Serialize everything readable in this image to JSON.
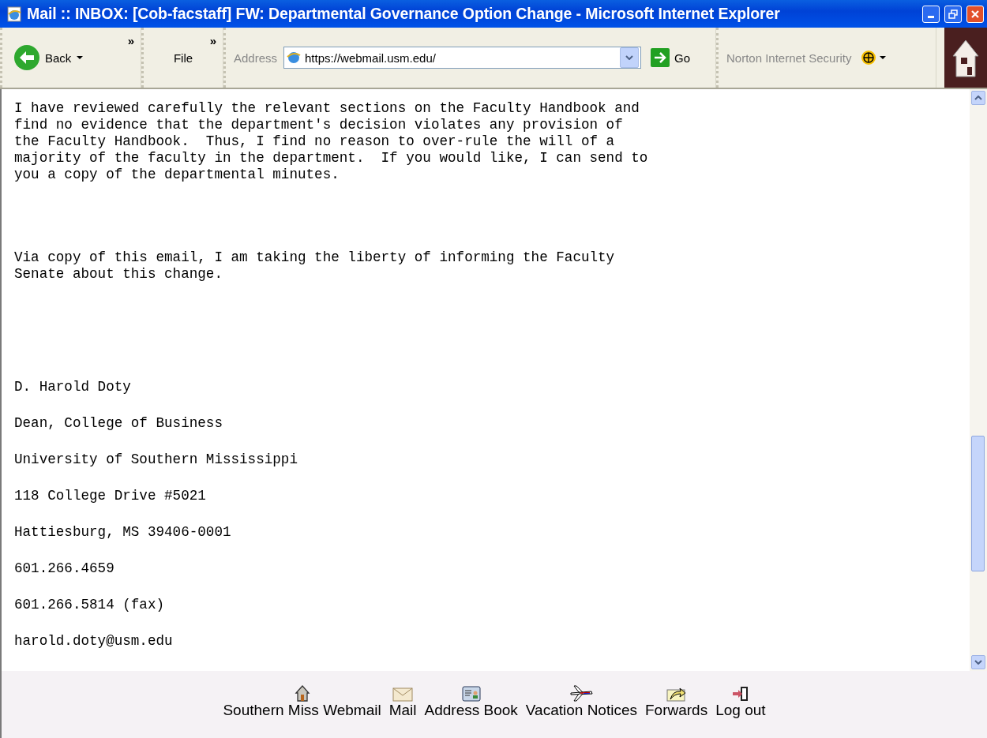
{
  "window": {
    "title": "Mail :: INBOX: [Cob-facstaff] FW: Departmental Governance Option Change - Microsoft Internet Explorer"
  },
  "toolbar": {
    "back": "Back",
    "chevron_1": "»",
    "file": "File",
    "chevron_2": "»",
    "address_label": "Address",
    "address": "https://webmail.usm.edu/",
    "go": "Go",
    "norton": "Norton Internet Security"
  },
  "message": [
    {
      "kind": "paragraph",
      "text": "I have reviewed carefully the relevant sections on the Faculty Handbook and\nfind no evidence that the department's decision violates any provision of\nthe Faculty Handbook.  Thus, I find no reason to over-rule the will of a\nmajority of the faculty in the department.  If you would like, I can send to\nyou a copy of the departmental minutes."
    },
    {
      "kind": "paragraph",
      "text": "Via copy of this email, I am taking the liberty of informing the Faculty\nSenate about this change."
    },
    {
      "kind": "signature",
      "text": "D. Harold Doty"
    },
    {
      "kind": "signature",
      "text": "Dean, College of Business"
    },
    {
      "kind": "signature",
      "text": "University of Southern Mississippi"
    },
    {
      "kind": "signature",
      "text": "118 College Drive #5021"
    },
    {
      "kind": "signature",
      "text": "Hattiesburg, MS 39406-0001"
    },
    {
      "kind": "signature",
      "text": "601.266.4659"
    },
    {
      "kind": "signature",
      "text": "601.266.5814 (fax)"
    },
    {
      "kind": "signature",
      "text": "harold.doty@usm.edu"
    }
  ],
  "footer_nav": [
    {
      "kind": "home",
      "label": "Southern Miss Webmail"
    },
    {
      "kind": "mail",
      "label": "Mail"
    },
    {
      "kind": "address_book",
      "label": "Address Book"
    },
    {
      "kind": "vacation",
      "label": "Vacation Notices"
    },
    {
      "kind": "forwards",
      "label": "Forwards"
    },
    {
      "kind": "logout",
      "label": "Log out"
    }
  ]
}
